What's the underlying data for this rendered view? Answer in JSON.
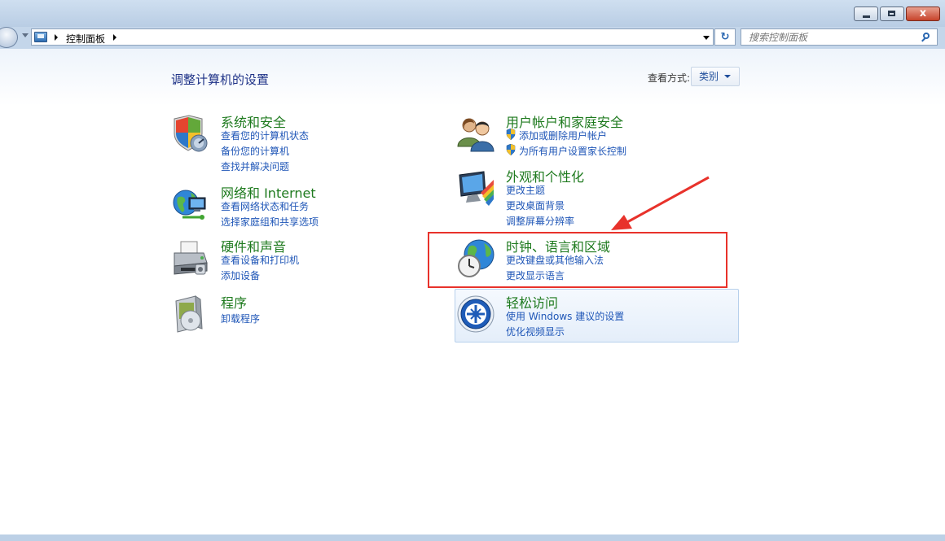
{
  "window": {
    "caption_buttons": [
      "minimize-icon",
      "maximize-icon",
      "close-icon"
    ],
    "close_glyph": "x"
  },
  "navbar": {
    "breadcrumb": "控制面板",
    "refresh_glyph": "↻",
    "search_placeholder": "搜索控制面板"
  },
  "main": {
    "title": "调整计算机的设置",
    "view_by": {
      "label": "查看方式:",
      "value": "类别"
    },
    "categories": [
      {
        "title": "系统和安全",
        "icon": "shield-computer-icon",
        "links": [
          "查看您的计算机状态",
          "备份您的计算机",
          "查找并解决问题"
        ]
      },
      {
        "title": "网络和 Internet",
        "icon": "network-globe-icon",
        "links": [
          "查看网络状态和任务",
          "选择家庭组和共享选项"
        ]
      },
      {
        "title": "硬件和声音",
        "icon": "printer-icon",
        "links": [
          "查看设备和打印机",
          "添加设备"
        ]
      },
      {
        "title": "程序",
        "icon": "programs-box-icon",
        "links": [
          "卸载程序"
        ]
      },
      {
        "title": "用户帐户和家庭安全",
        "icon": "users-icon",
        "links": [
          "添加或删除用户帐户",
          "为所有用户设置家长控制"
        ]
      },
      {
        "title": "外观和个性化",
        "icon": "monitor-paint-icon",
        "links": [
          "更改主题",
          "更改桌面背景",
          "调整屏幕分辨率"
        ]
      },
      {
        "title": "时钟、语言和区域",
        "icon": "clock-globe-icon",
        "links": [
          "更改键盘或其他输入法",
          "更改显示语言"
        ]
      },
      {
        "title": "轻松访问",
        "icon": "ease-of-access-icon",
        "links": [
          "使用 Windows 建议的设置",
          "优化视频显示"
        ]
      }
    ]
  },
  "annotation": {
    "color": "#e8322b"
  },
  "colors": {
    "title_green": "#1e7a1e",
    "link_blue": "#1f56b7",
    "header_blue": "#1e3287"
  }
}
